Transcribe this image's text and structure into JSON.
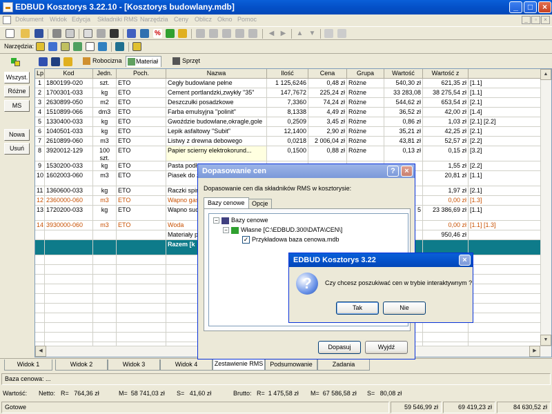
{
  "window": {
    "title": "EDBUD Kosztorys 3.22.10 - [Kosztorys budowlany.mdb]"
  },
  "menu": [
    "Dokument",
    "Widok",
    "Edycja",
    "Składniki RMS",
    "Narzędzia",
    "Ceny",
    "Oblicz",
    "Okno",
    "Pomoc"
  ],
  "toolbar2": {
    "label": "Narzędzia:"
  },
  "left_buttons": [
    "Wszyst.",
    "Różne",
    "MS",
    "Nowa",
    "Usuń"
  ],
  "subtabs": [
    "Robocizna",
    "Materiał",
    "Sprzęt"
  ],
  "grid": {
    "columns": [
      "Lp.",
      "Kod",
      "Jedn.",
      "Poch.",
      "Nazwa",
      "Ilość",
      "Cena",
      "Grupa",
      "Wartość",
      "Wartość z"
    ],
    "rows": [
      [
        "1",
        "1800199-020",
        "szt.",
        "ETO",
        "Cegły budowlane pełne",
        "1 125,6246",
        "0,48 zł",
        "Różne",
        "540,30 zł",
        "621,35 zł",
        "[1.1]"
      ],
      [
        "2",
        "1700301-033",
        "kg",
        "ETO",
        "Cement portlandzki,zwykły \"35\"",
        "147,7672",
        "225,24 zł",
        "Różne",
        "33 283,08",
        "38 275,54 zł",
        "[1.1]"
      ],
      [
        "3",
        "2630899-050",
        "m2",
        "ETO",
        "Deszczułki posadzkowe",
        "7,3360",
        "74,24 zł",
        "Różne",
        "544,62 zł",
        "653,54 zł",
        "[2.1]"
      ],
      [
        "4",
        "1510899-066",
        "dm3",
        "ETO",
        "Farba emulsyjna \"polinit\"",
        "8,1338",
        "4,49 zł",
        "Różne",
        "36,52 zł",
        "42,00 zł",
        "[1.4]"
      ],
      [
        "5",
        "1330400-033",
        "kg",
        "ETO",
        "Gwoździe budowlane,okragle,gole",
        "0,2509",
        "3,45 zł",
        "Różne",
        "0,86 zł",
        "1,03 zł",
        "[2.1] [2.2]"
      ],
      [
        "6",
        "1040501-033",
        "kg",
        "ETO",
        "Lepik asfaltowy \"Subit\"",
        "12,1400",
        "2,90 zł",
        "Różne",
        "35,21 zł",
        "42,25 zł",
        "[2.1]"
      ],
      [
        "7",
        "2610899-060",
        "m3",
        "ETO",
        "Listwy z drewna debowego",
        "0,0218",
        "2 006,04 zł",
        "Różne",
        "43,81 zł",
        "52,57 zł",
        "[2.2]"
      ],
      [
        "8",
        "3920012-129",
        "100 szt.",
        "ETO",
        "Papier scierny elektrokorund...",
        "0,1500",
        "0,88 zł",
        "Różne",
        "0,13 zł",
        "0,15 zł",
        "[3.2]"
      ],
      [
        "9",
        "1530200-033",
        "kg",
        "ETO",
        "Pasta podł",
        "",
        "",
        "",
        "",
        "1,55 zł",
        "[2.2]"
      ],
      [
        "10",
        "1602003-060",
        "m3",
        "ETO",
        "Piasek do z",
        "",
        "",
        "",
        "",
        "20,81 zł",
        "[1.1]"
      ],
      [
        "11",
        "1360600-033",
        "kg",
        "ETO",
        "Raczki spir",
        "",
        "",
        "",
        "",
        "1,97 zł",
        "[2.1]"
      ],
      [
        "12",
        "2360000-060",
        "m3",
        "ETO",
        "Wapno gas",
        "",
        "",
        "",
        "",
        "0,00 zł",
        "[1.3]"
      ],
      [
        "13",
        "1720200-033",
        "kg",
        "ETO",
        "Wapno suc (hydratyzov",
        "",
        "",
        "",
        "5",
        "23 386,69 zł",
        "[1.1]"
      ],
      [
        "14",
        "3930000-060",
        "m3",
        "ETO",
        "Woda",
        "",
        "",
        "",
        "",
        "0,00 zł",
        "[1.1] [1.3]"
      ],
      [
        "",
        "",
        "",
        "",
        "Materiały p",
        "",
        "",
        "",
        "",
        "950,46 zł",
        ""
      ]
    ],
    "sum_label": "Razem [k"
  },
  "bottom_tabs": [
    "Widok 1",
    "Widok 2",
    "Widok 3",
    "Widok 4",
    "Zestawienie RMS",
    "Podsumowanie",
    "Zadania"
  ],
  "baza_label": "Baza cenowa: ...",
  "wartosc": {
    "label": "Wartość:",
    "netto": "Netto:",
    "netto_r": "R=   764,36 zł",
    "netto_m": "M=  58 741,03 zł",
    "netto_s": "S=   41,60 zł",
    "brutto": "Brutto:",
    "brutto_r": "R=  1 475,58 zł",
    "brutto_m": "M=  67 586,58 zł",
    "brutto_s": "S=   80,08 zł"
  },
  "status": {
    "ready": "Gotowe",
    "v1": "59 546,99 zł",
    "v2": "69 419,23 zł",
    "v3": "84 630,52 zł"
  },
  "dialog1": {
    "title": "Dopasowanie cen",
    "text": "Dopasowanie cen dla składników RMS w kosztorysie:",
    "tabs": [
      "Bazy cenowe",
      "Opcje"
    ],
    "tree": [
      "Bazy cenowe",
      "Własne [C:\\EDBUD.300\\DATA\\CEN\\]",
      "Przykładowa baza cenowa.mdb"
    ],
    "ok": "Dopasuj",
    "exit": "Wyjdź"
  },
  "dialog2": {
    "title": "EDBUD Kosztorys 3.22",
    "text": "Czy chcesz poszukiwać cen w trybie interaktywnym ?",
    "yes": "Tak",
    "no": "Nie"
  }
}
